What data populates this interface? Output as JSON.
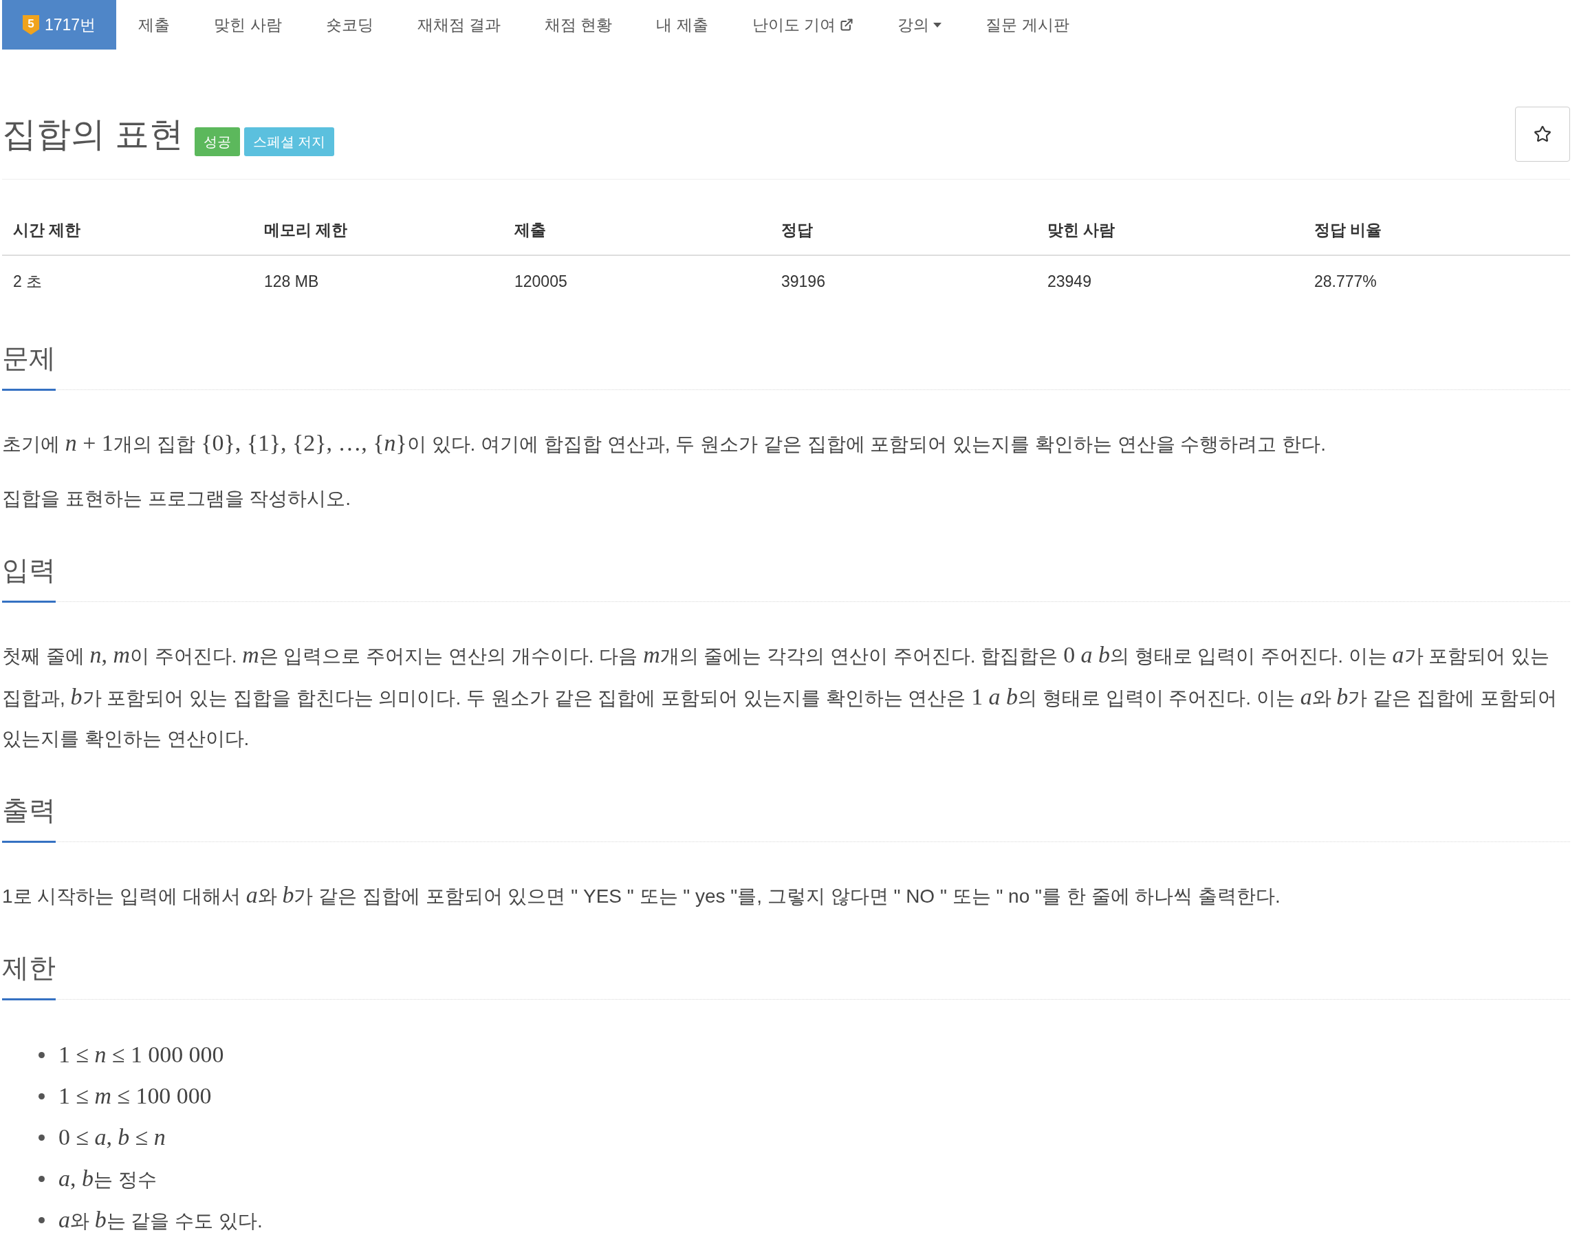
{
  "nav": {
    "items": [
      {
        "kind": "tier",
        "badge": "5",
        "label": "1717번",
        "selected": true
      },
      {
        "kind": "plain",
        "label": "제출",
        "selected": false
      },
      {
        "kind": "plain",
        "label": "맞힌 사람",
        "selected": false
      },
      {
        "kind": "plain",
        "label": "숏코딩",
        "selected": false
      },
      {
        "kind": "plain",
        "label": "재채점 결과",
        "selected": false
      },
      {
        "kind": "plain",
        "label": "채점 현황",
        "selected": false
      },
      {
        "kind": "plain",
        "label": "내 제출",
        "selected": false
      },
      {
        "kind": "external",
        "label": "난이도 기여",
        "selected": false
      },
      {
        "kind": "dropdown",
        "label": "강의",
        "selected": false
      },
      {
        "kind": "plain",
        "label": "질문 게시판",
        "selected": false
      }
    ]
  },
  "problem": {
    "title": "집합의 표현",
    "labels": [
      {
        "text": "성공",
        "color": "#5cb85c"
      },
      {
        "text": "스페셜 저지",
        "color": "#5bc0de"
      }
    ]
  },
  "stats": {
    "columns": [
      "시간 제한",
      "메모리 제한",
      "제출",
      "정답",
      "맞힌 사람",
      "정답 비율"
    ],
    "rows": [
      [
        "2 초",
        "128 MB",
        "120005",
        "39196",
        "23949",
        "28.777%"
      ]
    ]
  },
  "sections": [
    {
      "heading": "문제",
      "paragraphs": [
        [
          {
            "kind": "text",
            "text": "초기에 "
          },
          {
            "kind": "math",
            "text": "*n* + 1"
          },
          {
            "kind": "text",
            "text": "개의 집합 "
          },
          {
            "kind": "math",
            "text": "{0}, {1}, {2}, …, {*n*}"
          },
          {
            "kind": "text",
            "text": "이 있다. 여기에 합집합 연산과, 두 원소가 같은 집합에 포함되어 있는지를 확인하는 연산을 수행하려고 한다."
          }
        ],
        [
          {
            "kind": "text",
            "text": "집합을 표현하는 프로그램을 작성하시오."
          }
        ]
      ]
    },
    {
      "heading": "입력",
      "paragraphs": [
        [
          {
            "kind": "text",
            "text": "첫째 줄에 "
          },
          {
            "kind": "math",
            "text": "*n*, *m*"
          },
          {
            "kind": "text",
            "text": "이 주어진다. "
          },
          {
            "kind": "math",
            "text": "*m*"
          },
          {
            "kind": "text",
            "text": "은 입력으로 주어지는 연산의 개수이다. 다음 "
          },
          {
            "kind": "math",
            "text": "*m*"
          },
          {
            "kind": "text",
            "text": "개의 줄에는 각각의 연산이 주어진다. 합집합은 "
          },
          {
            "kind": "math",
            "text": "0 *a* *b*"
          },
          {
            "kind": "text",
            "text": "의 형태로 입력이 주어진다. 이는 "
          },
          {
            "kind": "math",
            "text": "*a*"
          },
          {
            "kind": "text",
            "text": "가 포함되어 있는 집합과, "
          },
          {
            "kind": "math",
            "text": "*b*"
          },
          {
            "kind": "text",
            "text": "가 포함되어 있는 집합을 합친다는 의미이다. 두 원소가 같은 집합에 포함되어 있는지를 확인하는 연산은 "
          },
          {
            "kind": "math",
            "text": "1 *a* *b*"
          },
          {
            "kind": "text",
            "text": "의 형태로 입력이 주어진다. 이는 "
          },
          {
            "kind": "math",
            "text": "*a*"
          },
          {
            "kind": "text",
            "text": "와 "
          },
          {
            "kind": "math",
            "text": "*b*"
          },
          {
            "kind": "text",
            "text": "가 같은 집합에 포함되어 있는지를 확인하는 연산이다."
          }
        ]
      ]
    },
    {
      "heading": "출력",
      "paragraphs": [
        [
          {
            "kind": "text",
            "text": "1로 시작하는 입력에 대해서 "
          },
          {
            "kind": "math",
            "text": "*a*"
          },
          {
            "kind": "text",
            "text": "와 "
          },
          {
            "kind": "math",
            "text": "*b*"
          },
          {
            "kind": "text",
            "text": "가 같은 집합에 포함되어 있으면 \" YES \" 또는 \" yes \"를, 그렇지 않다면 \" NO \" 또는 \" no \"를 한 줄에 하나씩 출력한다."
          }
        ]
      ]
    },
    {
      "heading": "제한",
      "bullets": [
        [
          {
            "kind": "math",
            "text": "1 ≤ *n* ≤ 1 000 000"
          }
        ],
        [
          {
            "kind": "math",
            "text": "1 ≤ *m* ≤ 100 000"
          }
        ],
        [
          {
            "kind": "math",
            "text": "0 ≤ *a*, *b* ≤ *n*"
          }
        ],
        [
          {
            "kind": "math",
            "text": "*a*, *b*"
          },
          {
            "kind": "text",
            "text": "는 정수"
          }
        ],
        [
          {
            "kind": "math",
            "text": "*a*"
          },
          {
            "kind": "text",
            "text": "와 "
          },
          {
            "kind": "math",
            "text": "*b*"
          },
          {
            "kind": "text",
            "text": "는 같을 수도 있다."
          }
        ]
      ]
    }
  ]
}
